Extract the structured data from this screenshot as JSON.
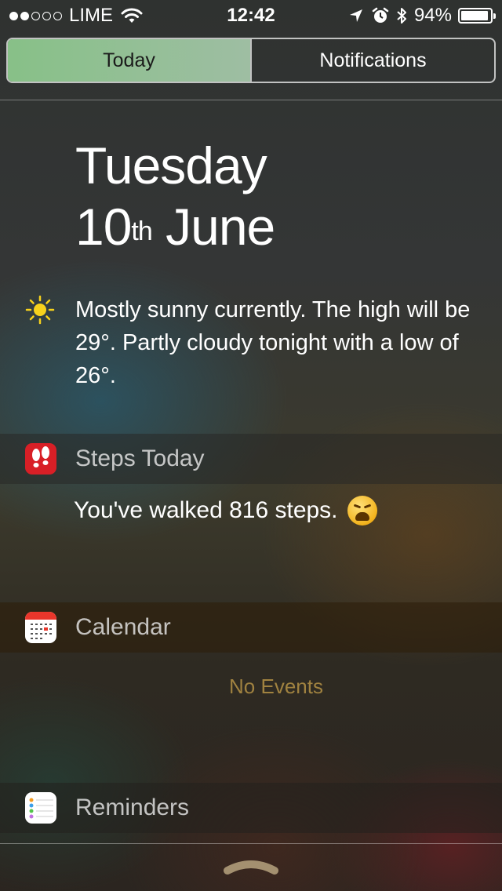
{
  "status_bar": {
    "signal_bars_filled": 2,
    "signal_bars_total": 5,
    "carrier": "LIME",
    "time": "12:42",
    "battery_percent": "94%",
    "battery_level": 0.94,
    "icons": [
      "wifi-icon",
      "location-arrow-icon",
      "alarm-icon",
      "bluetooth-icon",
      "battery-icon"
    ]
  },
  "tabs": [
    {
      "label": "Today",
      "active": true
    },
    {
      "label": "Notifications",
      "active": false
    }
  ],
  "date": {
    "weekday": "Tuesday",
    "day": "10",
    "suffix": "th",
    "month": "June"
  },
  "weather": {
    "icon": "sun-icon",
    "summary": "Mostly sunny currently. The high will be 29°. Partly cloudy tonight with a low of 26°."
  },
  "widgets": {
    "steps": {
      "title": "Steps Today",
      "icon": "footprints-icon",
      "message": "You've walked 816 steps.",
      "emoji": "weary-face-emoji"
    },
    "calendar": {
      "title": "Calendar",
      "icon": "calendar-icon",
      "empty_text": "No Events"
    },
    "reminders": {
      "title": "Reminders",
      "icon": "reminders-icon"
    }
  },
  "colors": {
    "tab_active_bg": "#8cc88c",
    "steps_icon_bg": "#d81f26",
    "calendar_header_red": "#e9362b",
    "no_events_text": "#a08240"
  }
}
